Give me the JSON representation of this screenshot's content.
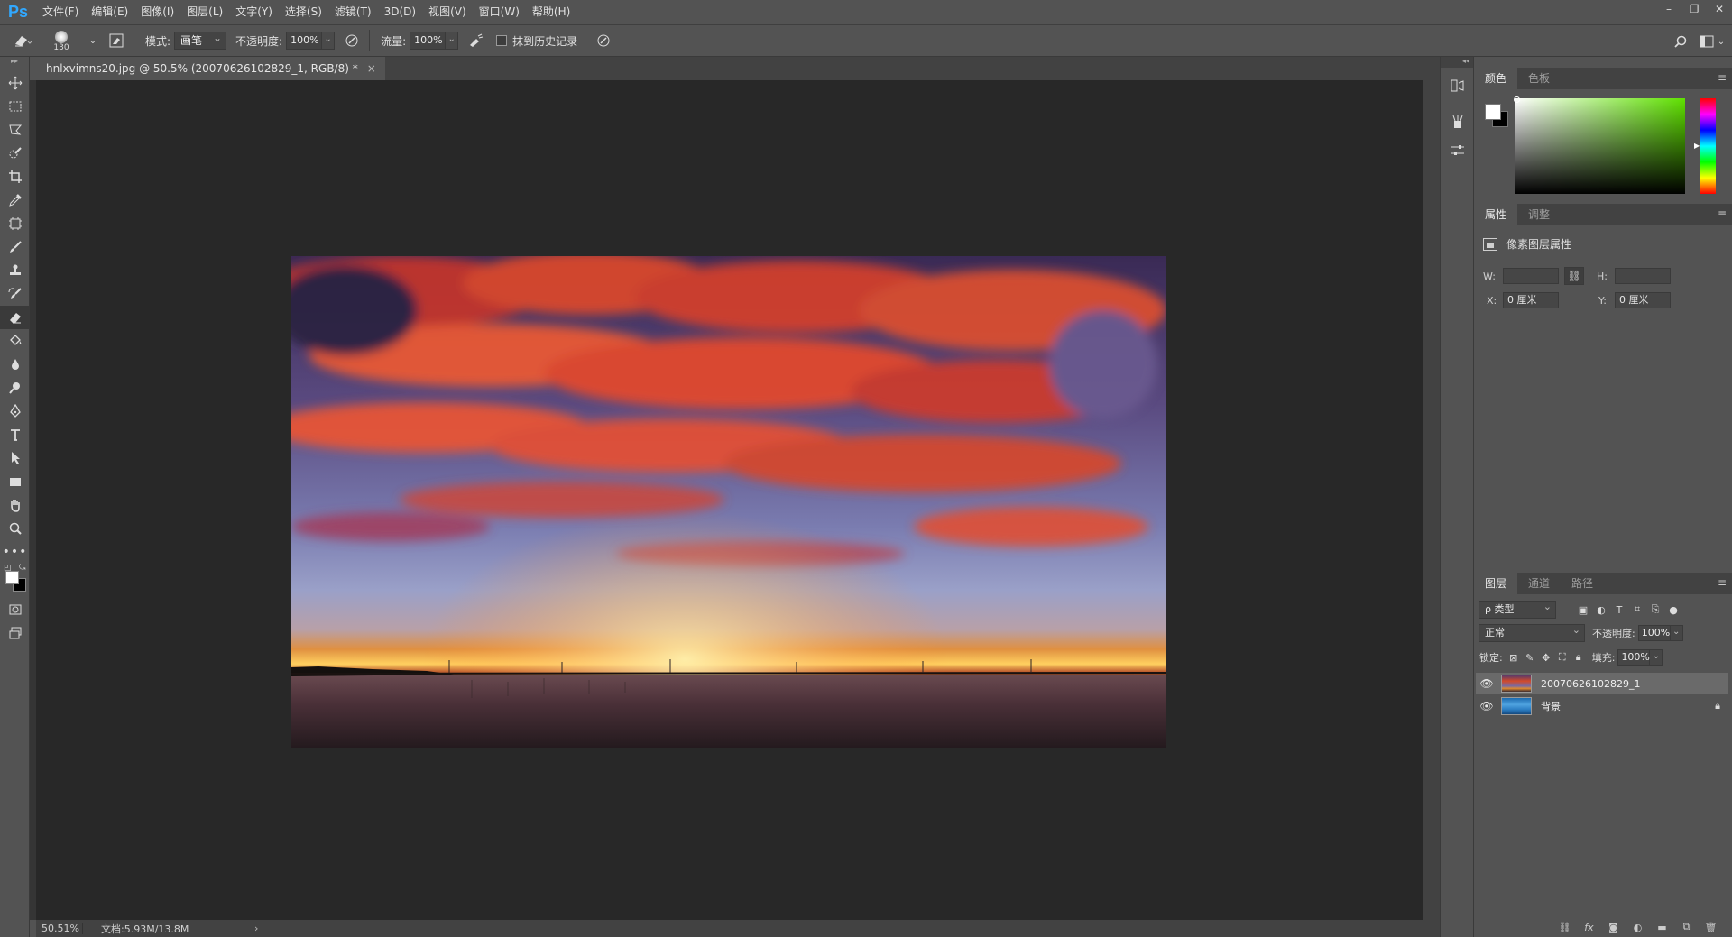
{
  "app": {
    "logo": "Ps"
  },
  "menu": [
    "文件(F)",
    "编辑(E)",
    "图像(I)",
    "图层(L)",
    "文字(Y)",
    "选择(S)",
    "滤镜(T)",
    "3D(D)",
    "视图(V)",
    "窗口(W)",
    "帮助(H)"
  ],
  "window_controls": {
    "minimize": "–",
    "restore": "❐",
    "close": "✕"
  },
  "options": {
    "brush_size": "130",
    "mode_label": "模式:",
    "mode_value": "画笔",
    "opacity_label": "不透明度:",
    "opacity_value": "100%",
    "flow_label": "流量:",
    "flow_value": "100%",
    "erase_history_label": "抹到历史记录"
  },
  "document": {
    "tab_title": "hnlxvimns20.jpg @ 50.5% (20070626102829_1, RGB/8) *",
    "close": "×"
  },
  "status": {
    "zoom": "50.51%",
    "doc_info": "文档:5.93M/13.8M",
    "arrow": "›"
  },
  "color_panel": {
    "tabs": [
      "颜色",
      "色板"
    ],
    "foreground": "#ffffff",
    "background": "#000000",
    "hue_color": "#5fe100"
  },
  "properties_panel": {
    "tabs": [
      "属性",
      "调整"
    ],
    "title": "像素图层属性",
    "w_label": "W:",
    "h_label": "H:",
    "x_label": "X:",
    "y_label": "Y:",
    "x_value": "0 厘米",
    "y_value": "0 厘米",
    "w_value": "",
    "h_value": ""
  },
  "layers_panel": {
    "tabs": [
      "图层",
      "通道",
      "路径"
    ],
    "filter_value": "ρ 类型",
    "blend_mode": "正常",
    "opacity_label": "不透明度:",
    "opacity_value": "100%",
    "lock_label": "锁定:",
    "fill_label": "填充:",
    "fill_value": "100%",
    "layers": [
      {
        "name": "20070626102829_1",
        "selected": true,
        "locked": false
      },
      {
        "name": "背景",
        "selected": false,
        "locked": true
      }
    ]
  },
  "colors": {
    "accent": "#31a8ff",
    "canvas_bg": "#282828",
    "chrome": "#535353"
  }
}
